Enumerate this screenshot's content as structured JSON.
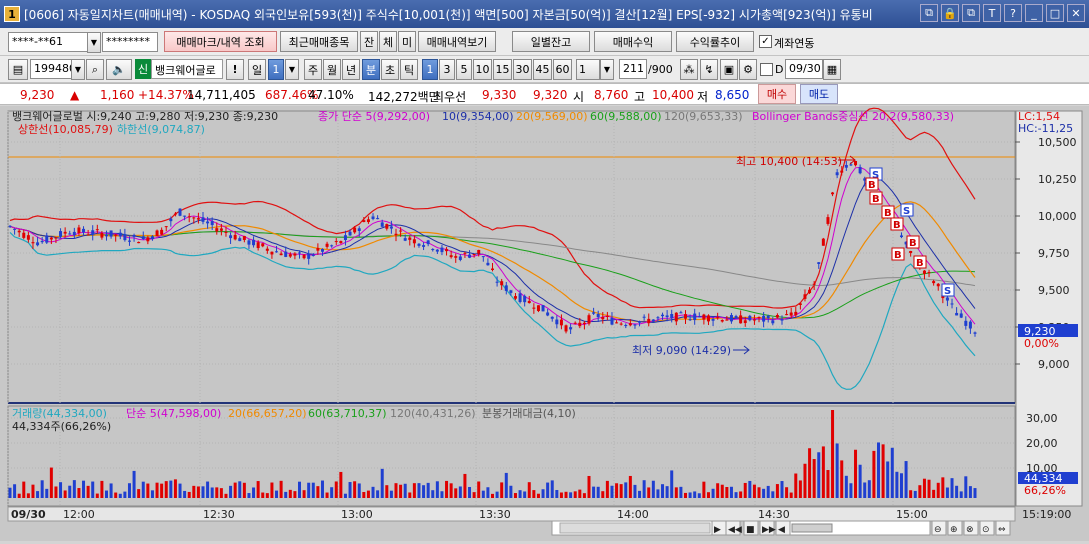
{
  "titlebar": {
    "badge": "1",
    "title": "[0606] 자동일지차트(매매내역) - KOSDAQ 외국인보유[593(천)] 주식수[10,001(천)] 액면[500] 자본금[50(억)] 결산[12월] EPS[-932] 시가총액[923(억)] 유통비",
    "buttons": [
      "⧉",
      "🔒",
      "⧉",
      "T",
      "?",
      "_",
      "□",
      "✕"
    ]
  },
  "toolbar1": {
    "account": "****-**61",
    "password": "********",
    "trade_mark_btn": "매매마크/내역 조회",
    "recent_items_btn": "최근매매종목",
    "balance_short": "잔",
    "fill_short": "체",
    "pending_short": "미",
    "trade_history_btn": "매매내역보기",
    "daily_balance_btn": "일별잔고",
    "trade_profit_btn": "매매수익",
    "return_trend_btn": "수익률추이",
    "account_link_label": "계좌연동",
    "account_link_checked": true
  },
  "toolbar2": {
    "code": "199480",
    "credit_badge": "신",
    "stock_name": "뱅크웨어글로",
    "warn": "!",
    "period_day": "일",
    "period_day_num": "1",
    "period_week": "주",
    "period_month": "월",
    "period_year": "년",
    "period_min": "분",
    "period_sec": "초",
    "period_tick": "틱",
    "min_options": [
      "1",
      "3",
      "5",
      "10",
      "15",
      "30",
      "45",
      "60"
    ],
    "min_selected": "1",
    "count_select": "1",
    "data_count": "211",
    "data_total": "/900",
    "date_label": "D",
    "date": "09/30"
  },
  "quote": {
    "price": "9,230",
    "arrow": "▲",
    "change": "1,160",
    "change_pct": "+14.37%",
    "volume": "14,711,405",
    "vol_ratio": "687.46%",
    "turnover": "47.10%",
    "amount": "142,272백만",
    "best_ask_label": "최우선",
    "best_ask": "9,330",
    "best_bid": "9,320",
    "open_label": "시",
    "open": "8,760",
    "high_label": "고",
    "high": "10,400",
    "low_label": "저",
    "low": "8,650",
    "buy_btn": "매수",
    "sell_btn": "매도"
  },
  "chart_data": {
    "type": "candlestick",
    "price_header": {
      "ohlc": "뱅크웨어글로벌 시:9,240 고:9,280 저:9,230 종:9,230",
      "ma_title": "종가 단순 5(9,292,00)",
      "ma10": "10(9,354,00)",
      "ma20": "20(9,569,00)",
      "ma60": "60(9,588,00)",
      "ma120": "120(9,653,33)",
      "bollinger": "Bollinger Bands중심선 20,2(9,580,33)",
      "upper": "상한선(10,085,79)",
      "lower": "하한선(9,074,87)",
      "lc": "LC:1,54",
      "hc": "HC:-11,25"
    },
    "y_ticks": [
      "10,500",
      "10,250",
      "10,000",
      "9,750",
      "9,500",
      "9,250",
      "9,000"
    ],
    "y_values": [
      10500,
      10250,
      10000,
      9750,
      9500,
      9250,
      9000
    ],
    "current_price": "9,230",
    "current_pct": "0,00%",
    "high_annot": "최고 10,400 (14:53)",
    "low_annot": "최저 9,090 (14:29)",
    "volume_header": {
      "vol": "거래량(44,334,00)",
      "ma5": "단순 5(47,598,00)",
      "ma20": "20(66,657,20)",
      "ma60": "60(63,710,37)",
      "ma120": "120(40,431,26)",
      "amount": "분봉거래대금(4,10)",
      "detail": "44,334주(66,26%)"
    },
    "vol_ticks": [
      "30,00",
      "20,00",
      "10,00"
    ],
    "vol_current": "44,334",
    "vol_pct": "66,26%",
    "x_ticks": [
      "09/30",
      "12:00",
      "12:30",
      "13:00",
      "13:30",
      "14:00",
      "14:30",
      "15:00"
    ],
    "x_end": "15:19:00",
    "colors": {
      "up": "#e00000",
      "down": "#1f3fd0",
      "ma5": "#d000d0",
      "ma10": "#1c2fa8",
      "ma20": "#f08a00",
      "ma60": "#1aa01a",
      "ma120": "#888888",
      "bb_mid": "#d03070",
      "bb_up": "#e01010",
      "bb_low": "#20a8c0"
    }
  }
}
